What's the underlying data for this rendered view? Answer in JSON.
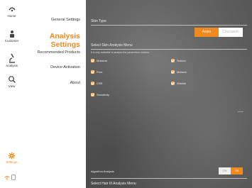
{
  "nav": {
    "items": [
      {
        "label": "Home",
        "icon": "home-icon"
      },
      {
        "label": "Customer",
        "icon": "customer-icon"
      },
      {
        "label": "Analysis",
        "icon": "analysis-microscope-icon"
      },
      {
        "label": "View",
        "icon": "search-icon"
      },
      {
        "label": "Settings",
        "icon": "gear-icon"
      }
    ],
    "accent": "#f08a1e"
  },
  "menu": {
    "items": [
      {
        "label": "General Settings"
      },
      {
        "label": "Analysis Settings",
        "active": true
      },
      {
        "label": "Recommended Products"
      },
      {
        "label": "Device Activation"
      },
      {
        "label": "About"
      }
    ]
  },
  "content": {
    "skin_type": {
      "title": "Skin Type",
      "options": [
        "Asian",
        "Caucasian"
      ],
      "selected": "Asian"
    },
    "skin_menu": {
      "title": "Select Skin Analysis Menu",
      "hint": "It is only available to analyze the parameters marked.",
      "params": [
        {
          "label": "Moisture",
          "checked": true
        },
        {
          "label": "Sebum",
          "checked": true
        },
        {
          "label": "Pore",
          "checked": true
        },
        {
          "label": "Melanin",
          "checked": true
        },
        {
          "label": "CSR",
          "checked": true
        },
        {
          "label": "Wrinkle",
          "checked": true
        },
        {
          "label": "Sensitivity",
          "checked": true
        }
      ]
    },
    "algorithm": {
      "title": "Algorithm Analysis",
      "options": [
        "ON",
        "Off"
      ],
      "selected": "Off"
    },
    "hair": {
      "title": "Select Hair III Analysis Menu"
    }
  }
}
